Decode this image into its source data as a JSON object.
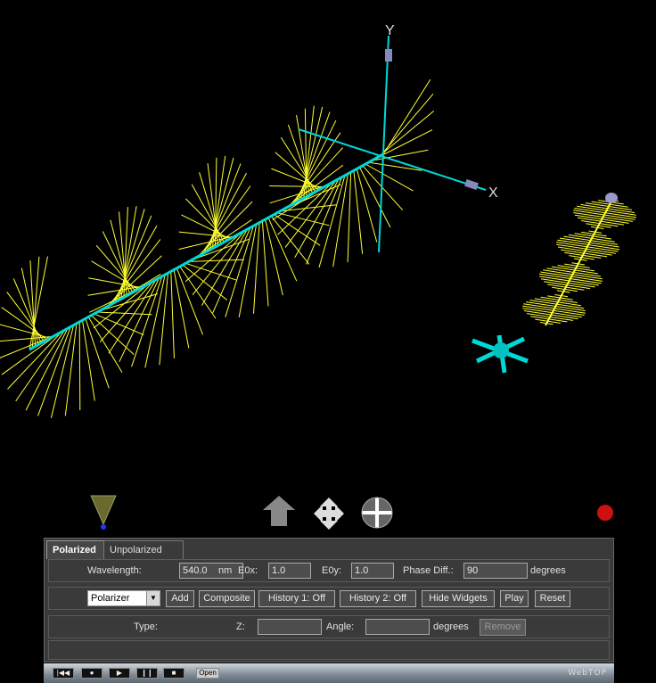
{
  "scene": {
    "axis_y_label": "Y",
    "axis_x_label": "X",
    "colors": {
      "wave": "#ffff33",
      "axis": "#00d8d8",
      "background": "#000000",
      "record": "#cc1111"
    },
    "icons": [
      "cone-navigator-icon",
      "pan-up-arrow-icon",
      "move-arrows-icon",
      "rotate-sphere-icon",
      "record-indicator-icon",
      "polarizer-widget-icon",
      "rotation-handle-icon"
    ]
  },
  "tabs": [
    {
      "label": "Polarized",
      "active": true
    },
    {
      "label": "Unpolarized",
      "active": false
    }
  ],
  "row1": {
    "wavelength_label": "Wavelength:",
    "wavelength_value": "540.0",
    "wavelength_unit": "nm",
    "e0x_label": "E0x:",
    "e0x_value": "1.0",
    "e0y_label": "E0y:",
    "e0y_value": "1.0",
    "phase_label": "Phase Diff.:",
    "phase_value": "90",
    "phase_unit": "degrees"
  },
  "row2": {
    "element_select": "Polarizer",
    "add": "Add",
    "composite": "Composite",
    "history1": "History 1: Off",
    "history2": "History 2: Off",
    "hide_widgets": "Hide Widgets",
    "play": "Play",
    "reset": "Reset"
  },
  "row3": {
    "type_label": "Type:",
    "z_label": "Z:",
    "z_value": "",
    "angle_label": "Angle:",
    "angle_value": "",
    "angle_unit": "degrees",
    "remove": "Remove"
  },
  "footer": {
    "open": "Open",
    "brand": "WebTOP",
    "controls": [
      "rewind",
      "record",
      "play",
      "pause",
      "stop"
    ]
  }
}
